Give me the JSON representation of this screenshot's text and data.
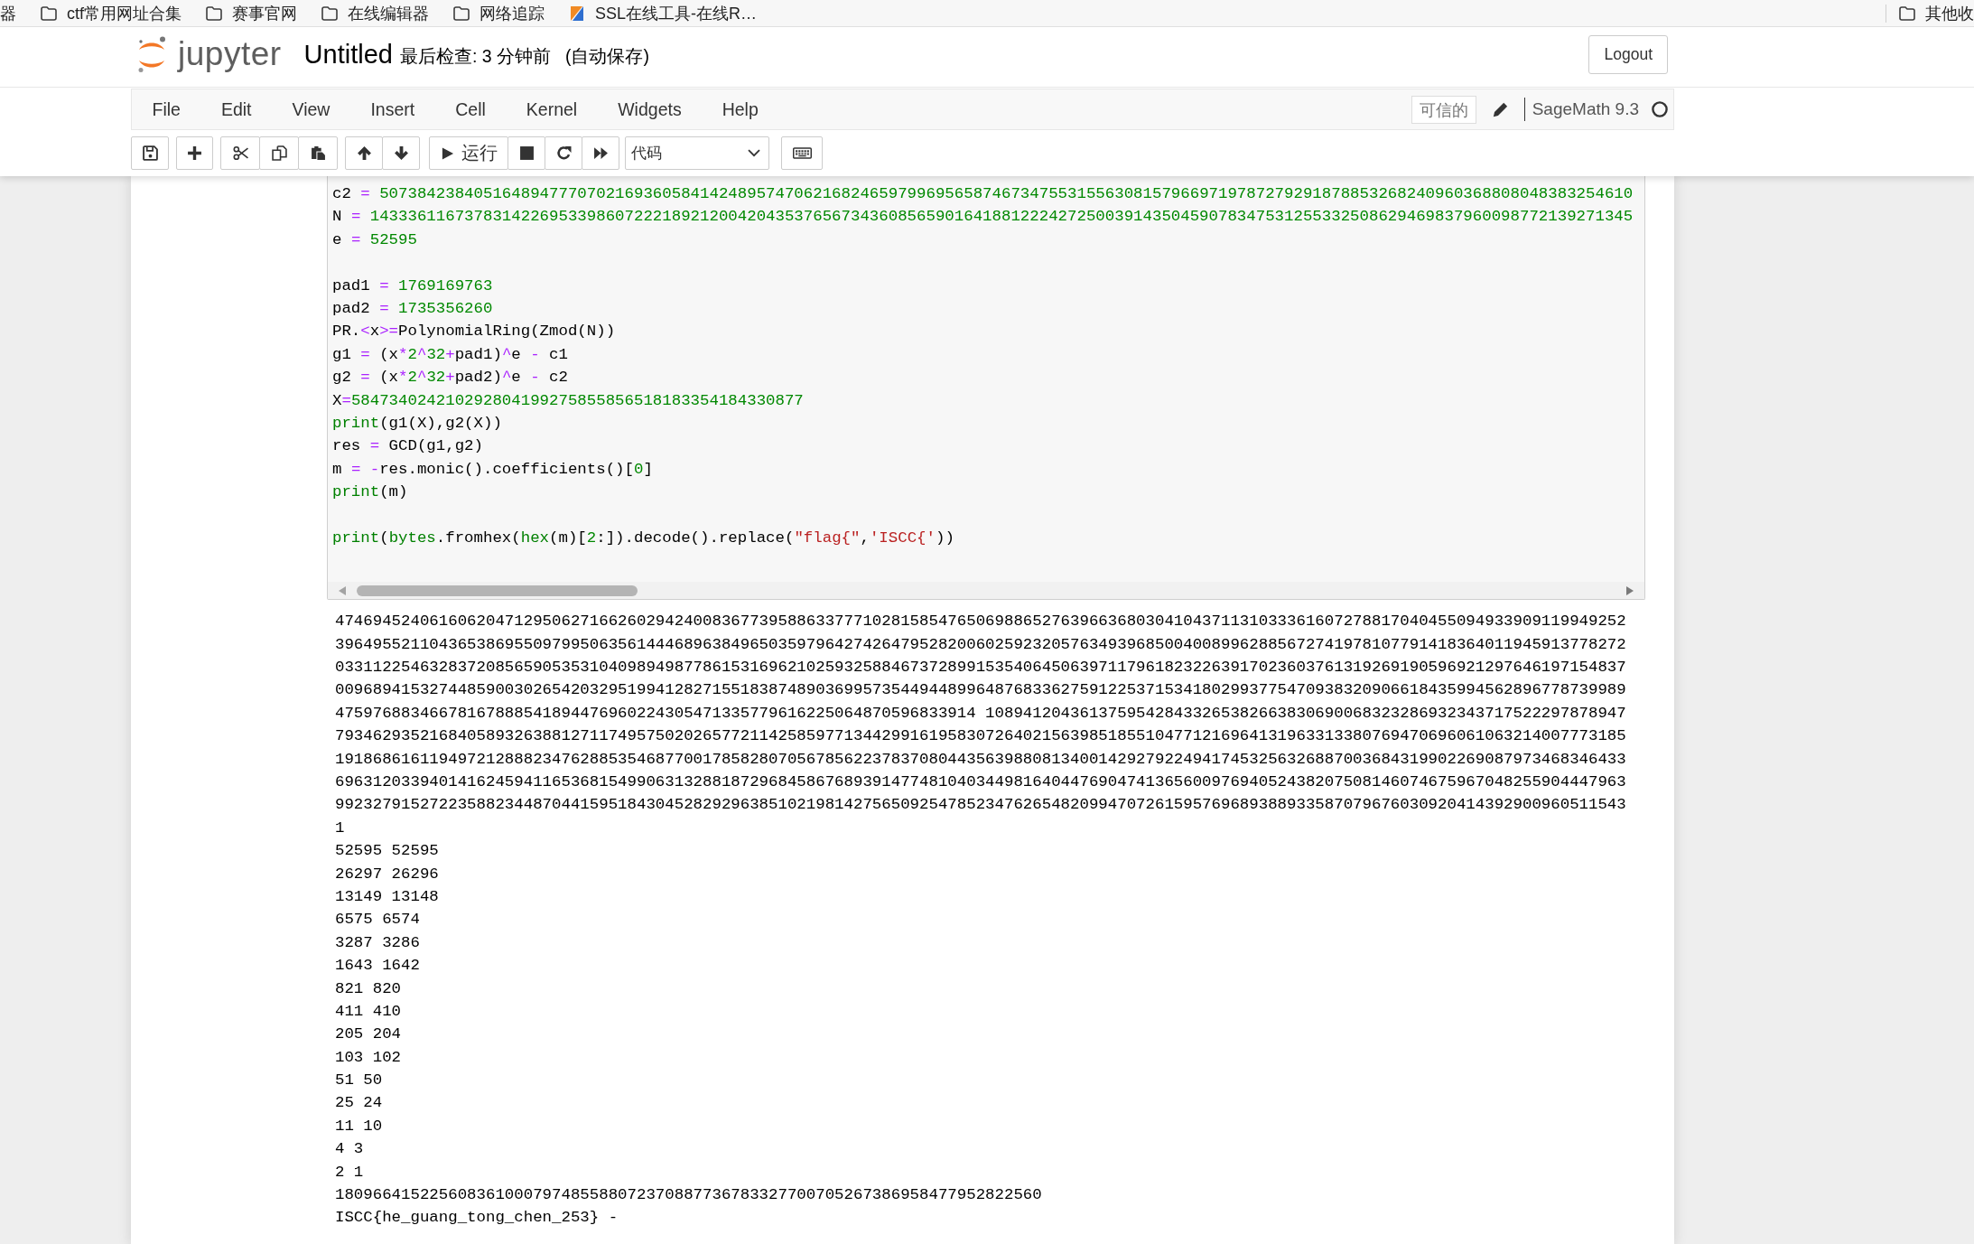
{
  "bookmarks_bar": {
    "items": [
      {
        "label": "器",
        "kind": "none"
      },
      {
        "label": "ctf常用网址合集",
        "kind": "folder"
      },
      {
        "label": "赛事官网",
        "kind": "folder"
      },
      {
        "label": "在线编辑器",
        "kind": "folder"
      },
      {
        "label": "网络追踪",
        "kind": "folder"
      },
      {
        "label": "SSL在线工具-在线R…",
        "kind": "favicon"
      }
    ],
    "right_items": [
      {
        "label": "其他收",
        "kind": "folder"
      }
    ]
  },
  "header": {
    "logo_text": "jupyter",
    "notebook_title": "Untitled",
    "checkpoint": "最后检查: 3 分钟前",
    "autosave": "(自动保存)",
    "logout": "Logout"
  },
  "menubar": {
    "items": [
      "File",
      "Edit",
      "View",
      "Insert",
      "Cell",
      "Kernel",
      "Widgets",
      "Help"
    ],
    "trusted": "可信的",
    "kernel": {
      "name": "SageMath 9.3",
      "busy": false
    }
  },
  "toolbar": {
    "run_label": "运行",
    "cell_type": "代码"
  },
  "code_cell": {
    "blocks": [
      [
        [
          {
            "text": "c2 ",
            "kind": "name"
          },
          {
            "text": "=",
            "kind": "op"
          },
          {
            "text": " 5073842384051648947770702169360584142489574706216824659799695658746734755315563081579669719787279291878853268240960368808048383254610",
            "kind": "num"
          }
        ],
        [
          {
            "text": "N ",
            "kind": "name"
          },
          {
            "text": "=",
            "kind": "op"
          },
          {
            "text": " 14333611673783142269533986072221892120042043537656734360856590164188122242725003914350459078347531255332508629469837960098772139271345",
            "kind": "num"
          }
        ],
        [
          {
            "text": "e ",
            "kind": "name"
          },
          {
            "text": "=",
            "kind": "op"
          },
          {
            "text": " 52595",
            "kind": "num"
          }
        ]
      ],
      [
        [
          {
            "text": "pad1 ",
            "kind": "name"
          },
          {
            "text": "=",
            "kind": "op"
          },
          {
            "text": " 1769169763",
            "kind": "num"
          }
        ],
        [
          {
            "text": "pad2 ",
            "kind": "name"
          },
          {
            "text": "=",
            "kind": "op"
          },
          {
            "text": " 1735356260",
            "kind": "num"
          }
        ],
        [
          {
            "text": "PR.",
            "kind": "name"
          },
          {
            "text": "<",
            "kind": "op"
          },
          {
            "text": "x",
            "kind": "name"
          },
          {
            "text": ">=",
            "kind": "op"
          },
          {
            "text": "PolynomialRing(Zmod(N))",
            "kind": "name"
          }
        ],
        [
          {
            "text": "g1 ",
            "kind": "name"
          },
          {
            "text": "=",
            "kind": "op"
          },
          {
            "text": " (x",
            "kind": "name"
          },
          {
            "text": "*",
            "kind": "op"
          },
          {
            "text": "2",
            "kind": "num"
          },
          {
            "text": "^",
            "kind": "op"
          },
          {
            "text": "32",
            "kind": "num"
          },
          {
            "text": "+",
            "kind": "op"
          },
          {
            "text": "pad1)",
            "kind": "name"
          },
          {
            "text": "^",
            "kind": "op"
          },
          {
            "text": "e ",
            "kind": "name"
          },
          {
            "text": "-",
            "kind": "op"
          },
          {
            "text": " c1",
            "kind": "name"
          }
        ],
        [
          {
            "text": "g2 ",
            "kind": "name"
          },
          {
            "text": "=",
            "kind": "op"
          },
          {
            "text": " (x",
            "kind": "name"
          },
          {
            "text": "*",
            "kind": "op"
          },
          {
            "text": "2",
            "kind": "num"
          },
          {
            "text": "^",
            "kind": "op"
          },
          {
            "text": "32",
            "kind": "num"
          },
          {
            "text": "+",
            "kind": "op"
          },
          {
            "text": "pad2)",
            "kind": "name"
          },
          {
            "text": "^",
            "kind": "op"
          },
          {
            "text": "e ",
            "kind": "name"
          },
          {
            "text": "-",
            "kind": "op"
          },
          {
            "text": " c2",
            "kind": "name"
          }
        ],
        [
          {
            "text": "X",
            "kind": "name"
          },
          {
            "text": "=",
            "kind": "op"
          },
          {
            "text": "584734024210292804199275855856518183354184330877",
            "kind": "num"
          }
        ],
        [
          {
            "text": "print",
            "kind": "builtin"
          },
          {
            "text": "(g1(X),g2(X))",
            "kind": "name"
          }
        ],
        [
          {
            "text": "res ",
            "kind": "name"
          },
          {
            "text": "=",
            "kind": "op"
          },
          {
            "text": " GCD(g1,g2)",
            "kind": "name"
          }
        ],
        [
          {
            "text": "m ",
            "kind": "name"
          },
          {
            "text": "= -",
            "kind": "op"
          },
          {
            "text": "res.monic().coefficients()[",
            "kind": "name"
          },
          {
            "text": "0",
            "kind": "num"
          },
          {
            "text": "]",
            "kind": "name"
          }
        ],
        [
          {
            "text": "print",
            "kind": "builtin"
          },
          {
            "text": "(m)",
            "kind": "name"
          }
        ]
      ],
      [
        [
          {
            "text": "print",
            "kind": "builtin"
          },
          {
            "text": "(",
            "kind": "name"
          },
          {
            "text": "bytes",
            "kind": "builtin"
          },
          {
            "text": ".fromhex(",
            "kind": "name"
          },
          {
            "text": "hex",
            "kind": "builtin"
          },
          {
            "text": "(m)[",
            "kind": "name"
          },
          {
            "text": "2",
            "kind": "num"
          },
          {
            "text": ":]).decode().replace(",
            "kind": "name"
          },
          {
            "text": "\"flag{\"",
            "kind": "str"
          },
          {
            "text": ",",
            "kind": "name"
          },
          {
            "text": "'ISCC{'",
            "kind": "str"
          },
          {
            "text": "))",
            "kind": "name"
          }
        ]
      ]
    ]
  },
  "output": {
    "lines": [
      "47469452406160620471295062716626029424008367739588633777102815854765069886527639663680304104371131033361607278817040455094933909119949252",
      "39649552110436538695509799506356144468963849650359796427426479528200602592320576349396850040089962885672741978107791418364011945913778272",
      "03311225463283720856590535310409894987786153169621025932588467372899153540645063971179618232263917023603761319269190596921297646197154837",
      "00968941532744859003026542032951994128271551838748903699573544944899648768336275912253715341802993775470938320906618435994562896778739989",
      "47597688346678167888541894476960224305471335779616225064870596833914 10894120436137595428433265382663830690068323286932343717522297878947",
      "79346293521684058932638812711749575020265772114258597713442991619583072640215639851855104771216964131963313380769470696061063214007773185",
      "19186861611949721288823476288535468770017858280705678562237837080443563988081340014292792249417453256326887003684319902269087973468346433",
      "69631203394014162459411653681549906313288187296845867689391477481040344981640447690474136560097694052438207508146074675967048255904447963",
      "99232791527223588234487044159518430452829296385102198142756509254785234762654820994707261595769689388933587079676030920414392900960511543",
      "1",
      "52595 52595",
      "26297 26296",
      "13149 13148",
      "6575 6574",
      "3287 3286",
      "1643 1642",
      "821 820",
      "411 410",
      "205 204",
      "103 102",
      "51 50",
      "25 24",
      "11 10",
      "4 3",
      "2 1",
      "180966415225608361000797485588072370887736783327700705267386958477952822560",
      "ISCC{he_guang_tong_chen_253} -"
    ]
  }
}
